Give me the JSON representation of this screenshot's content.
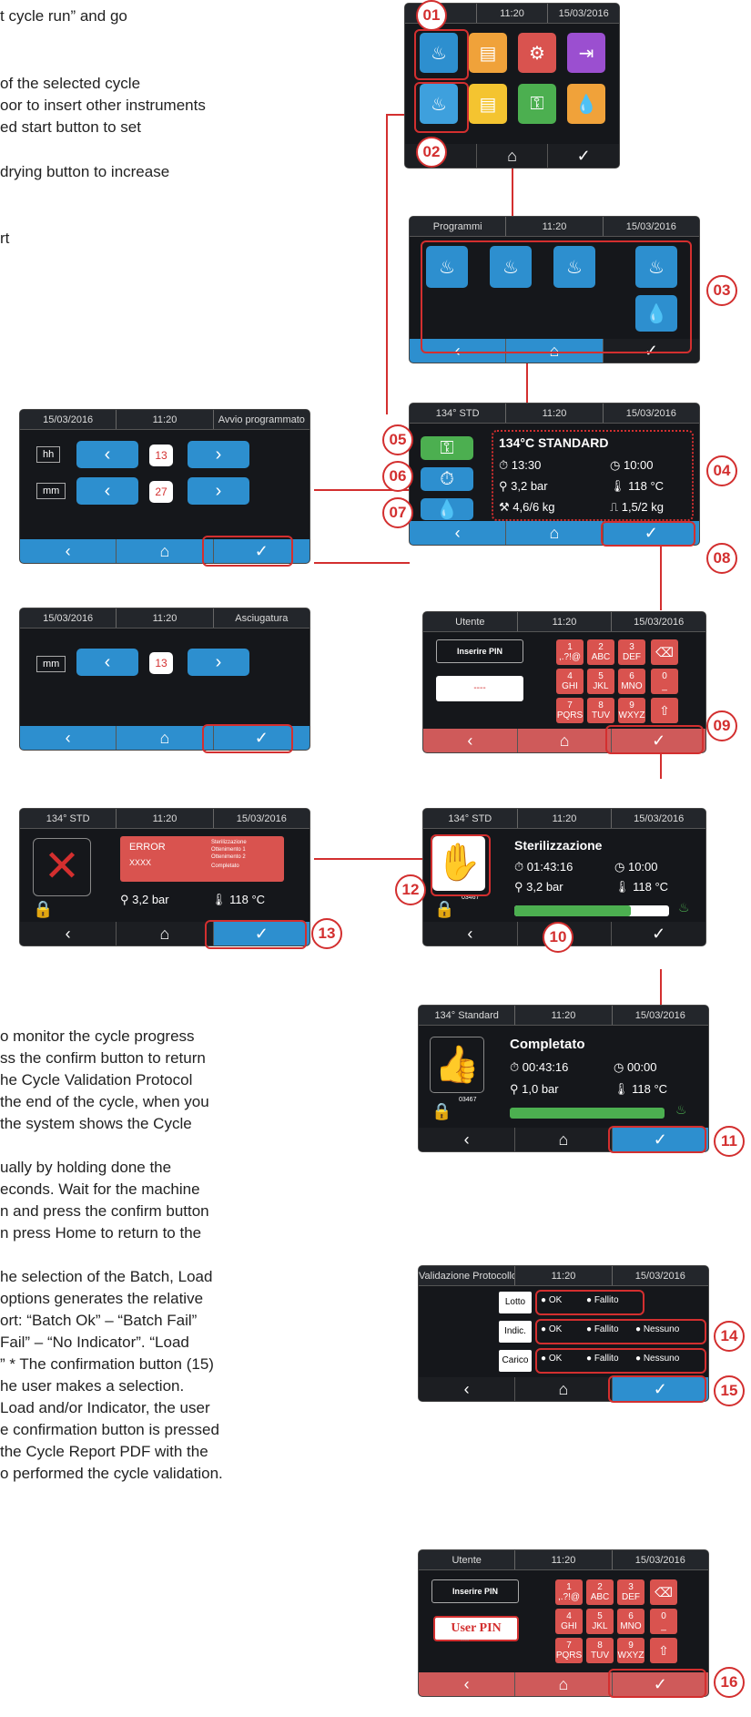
{
  "left_text": {
    "l1": "t cycle run” and go",
    "l2": "of the selected cycle",
    "l3": "oor to insert other instruments",
    "l4": "ed start button to set",
    "l5": "drying button to increase",
    "l6": "rt",
    "p1": [
      "o monitor the cycle progress",
      "ss the confirm button to return",
      "he Cycle Validation Protocol",
      "the end of the cycle, when you",
      "the system shows the Cycle"
    ],
    "p2": [
      "ually by holding done the",
      "econds. Wait for the machine",
      "n and press the confirm button",
      "n press Home to return to the"
    ],
    "p3": [
      "he selection of the Batch, Load",
      "options generates the relative",
      "ort: “Batch Ok” – “Batch Fail”",
      " Fail” – “No Indicator”. “Load",
      "” * The confirmation button (15)",
      "he user makes a selection.",
      "Load and/or Indicator, the user",
      "e confirmation button is pressed",
      "the Cycle Report PDF with the",
      "o performed the cycle validation."
    ]
  },
  "badges": [
    "01",
    "02",
    "03",
    "04",
    "05",
    "06",
    "07",
    "08",
    "09",
    "10",
    "11",
    "12",
    "13",
    "14",
    "15",
    "16"
  ],
  "scr1": {
    "time": "11:20",
    "date": "15/03/2016"
  },
  "scr3": {
    "title": "Programmi",
    "time": "11:20",
    "date": "15/03/2016"
  },
  "scr4": {
    "title": "134° STD",
    "time": "11:20",
    "date": "15/03/2016",
    "prog": "134°C STANDARD",
    "t1": "13:30",
    "t2": "10:00",
    "p": "3,2 bar",
    "temp": "118 °C",
    "w1": "4,6/6 kg",
    "w2": "1,5/2 kg"
  },
  "scrL1": {
    "date": "15/03/2016",
    "time": "11:20",
    "title": "Avvio programmato",
    "hh": "hh",
    "mm": "mm",
    "v1": "13",
    "v2": "27"
  },
  "scrL2": {
    "date": "15/03/2016",
    "time": "11:20",
    "title": "Asciugatura",
    "mm": "mm",
    "v1": "13"
  },
  "scrPin": {
    "title": "Utente",
    "time": "11:20",
    "date": "15/03/2016",
    "label": "Inserire PIN",
    "dots": "----",
    "keys": [
      "1\n,.?!@",
      "2\nABC",
      "3\nDEF",
      "4\nGHI",
      "5\nJKL",
      "6\nMNO",
      "7\nPQRS",
      "8\nTUV",
      "9\nWXYZ",
      "0\n_"
    ]
  },
  "scrErr": {
    "title": "134° STD",
    "time": "11:20",
    "date": "15/03/2016",
    "err": "ERROR",
    "code": "XXXX",
    "info1": "Sterilizzazione",
    "info2": "Ottenimento 1",
    "info3": "Ottenimento 2",
    "info4": "Completato",
    "p": "3,2 bar",
    "temp": "118 °C"
  },
  "scrSter": {
    "title": "134° STD",
    "time": "11:20",
    "date": "15/03/2016",
    "status": "Sterilizzazione",
    "t1": "01:43:16",
    "t2": "10:00",
    "p": "3,2 bar",
    "temp": "118 °C",
    "id": "03467"
  },
  "scrDone": {
    "title": "134° Standard",
    "time": "11:20",
    "date": "15/03/2016",
    "status": "Completato",
    "t1": "00:43:16",
    "t2": "00:00",
    "p": "1,0 bar",
    "temp": "118 °C",
    "id": "03467"
  },
  "scrVal": {
    "title": "Validazione Protocollo",
    "time": "11:20",
    "date": "15/03/2016",
    "r1": "Lotto",
    "r2": "Indic.",
    "r3": "Carico",
    "ok": "OK",
    "fail": "Fallito",
    "none": "Nessuno"
  },
  "scrPin2": {
    "title": "Utente",
    "time": "11:20",
    "date": "15/03/2016",
    "label": "Inserire PIN",
    "user": "User PIN",
    "dots": "----"
  }
}
